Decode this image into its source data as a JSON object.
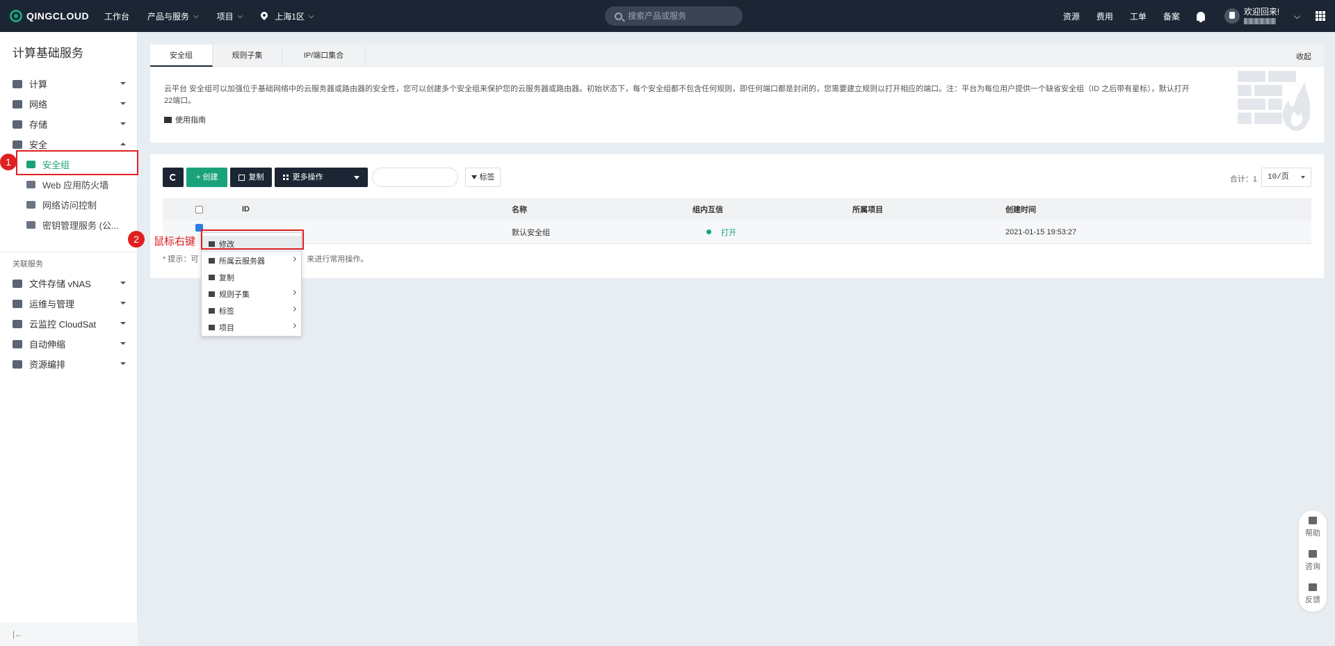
{
  "topbar": {
    "brand": "QINGCLOUD",
    "nav": [
      "工作台",
      "产品与服务",
      "项目"
    ],
    "region": "上海1区",
    "search_placeholder": "搜索产品或服务",
    "links": [
      "资源",
      "费用",
      "工单",
      "备案"
    ],
    "welcome": "欢迎回来!"
  },
  "sidebar": {
    "title": "计算基础服务",
    "items": [
      "计算",
      "网络",
      "存储",
      "安全"
    ],
    "sub_items": [
      "安全组",
      "Web 应用防火墙",
      "网络访问控制",
      "密钥管理服务 (公..."
    ],
    "section": "关联服务",
    "related": [
      "文件存储 vNAS",
      "运维与管理",
      "云监控 CloudSat",
      "自动伸缩",
      "资源编排"
    ],
    "collapse": "|←"
  },
  "annotations": {
    "num1": "1",
    "num2": "2",
    "label2": "鼠标右键"
  },
  "info": {
    "tabs": [
      "安全组",
      "规则子集",
      "IP/端口集合"
    ],
    "collapse": "收起",
    "text": "云平台 安全组可以加强位于基础网络中的云服务器或路由器的安全性，您可以创建多个安全组来保护您的云服务器或路由器。初始状态下，每个安全组都不包含任何规则，即任何端口都是封闭的，您需要建立规则以打开相应的端口。注：平台为每位用户提供一个缺省安全组（ID 之后带有星标），默认打开22端口。",
    "guide": "使用指南"
  },
  "toolbar": {
    "create": "+ 创建",
    "copy": "复制",
    "more": "更多操作",
    "tag": "标签",
    "total": "合计：1",
    "page_size": "10/页"
  },
  "table": {
    "headers": [
      "ID",
      "名称",
      "组内互信",
      "所属项目",
      "创建时间"
    ],
    "row": {
      "name": "默认安全组",
      "trust": "打开",
      "project": "",
      "created": "2021-01-15 19:53:27"
    },
    "hint_start": "* 提示：可",
    "hint_end": "来进行常用操作。"
  },
  "context_menu": [
    "修改",
    "所属云服务器",
    "复制",
    "规则子集",
    "标签",
    "项目"
  ],
  "float_help": [
    "帮助",
    "咨询",
    "反馈"
  ],
  "colors": {
    "accent": "#1aa37a",
    "dark": "#1b2533",
    "annotation": "#e02020"
  }
}
